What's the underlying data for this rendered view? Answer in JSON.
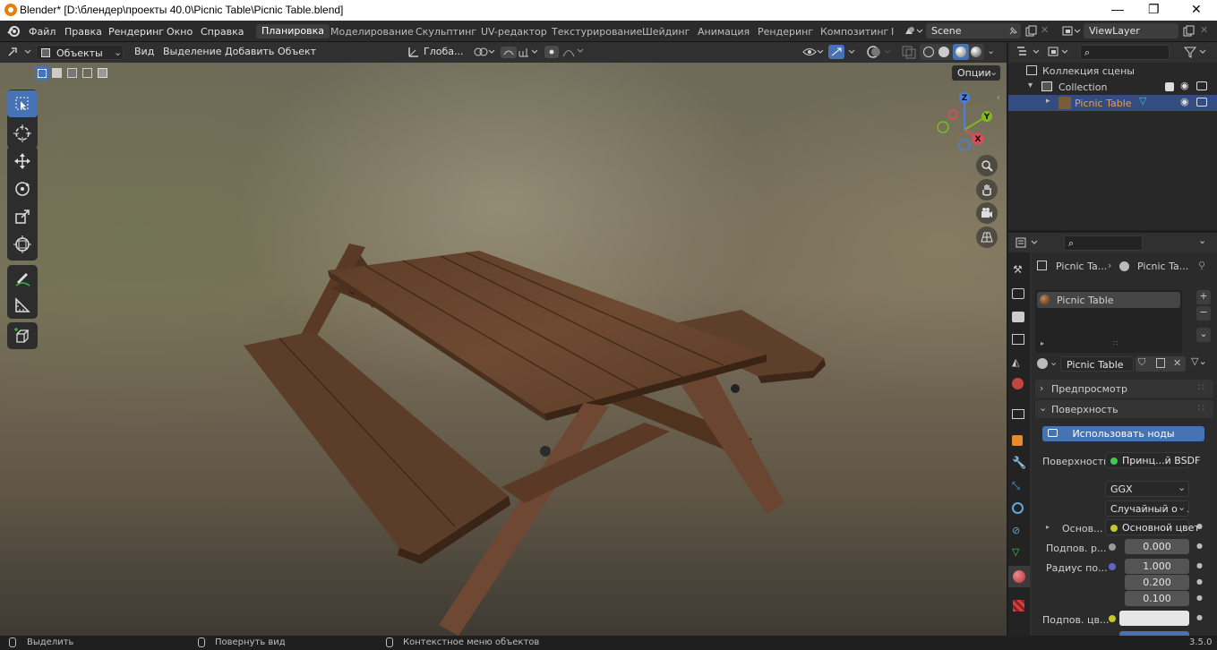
{
  "window": {
    "title": "Blender* [D:\\блендер\\проекты 40.0\\Picnic Table\\Picnic Table.blend]",
    "controls": [
      "—",
      "❐",
      "✕"
    ]
  },
  "menubar": {
    "menus": [
      "Файл",
      "Правка",
      "Рендеринг",
      "Окно",
      "Справка"
    ],
    "workspaces": [
      "Планировка",
      "Моделирование",
      "Скульптинг",
      "UV-редактор",
      "Текстурирование",
      "Шейдинг",
      "Анимация",
      "Рендеринг",
      "Композитинг"
    ],
    "active_workspace": "Планировка",
    "more_marker": "I",
    "scene": "Scene",
    "view_layer": "ViewLayer"
  },
  "viewport_header": {
    "mode": "Объекты",
    "menus": [
      "Вид",
      "Выделение",
      "Добавить",
      "Объект"
    ],
    "orientation": "Глоба...",
    "options": "Опции"
  },
  "toolbar": {
    "tools": [
      "select-box",
      "cursor",
      "move",
      "rotate",
      "scale",
      "transform",
      "annotate",
      "measure",
      "add-cube"
    ],
    "active_tool": "select-box"
  },
  "gizmo": {
    "axes": [
      "Z",
      "Y",
      "X"
    ]
  },
  "outliner": {
    "scene_collection": "Коллекция сцены",
    "collection": "Collection",
    "object": "Picnic Table"
  },
  "properties": {
    "breadcrumb_object": "Picnic Ta...",
    "breadcrumb_material": "Picnic Ta...",
    "slot_name": "Picnic Table",
    "material_name": "Picnic Table",
    "panels": {
      "preview": "Предпросмотр",
      "surface": "Поверхность"
    },
    "use_nodes_button": "Использовать ноды",
    "surface_label": "Поверхность",
    "surface_shader": "Принц...й BSDF",
    "distribution": "GGX",
    "subsurface_method": "Случайный об...",
    "rows": [
      {
        "label": "Основ...",
        "value": "Основной цвет"
      },
      {
        "label": "Подпов. р...",
        "value": "0.000"
      },
      {
        "label": "Радиус по...",
        "values": [
          "1.000",
          "0.200",
          "0.100"
        ]
      },
      {
        "label": "Подпов. цв...",
        "value": ""
      }
    ]
  },
  "statusbar": {
    "items": [
      "Выделить",
      "Повернуть вид",
      "Контекстное меню объектов"
    ],
    "version": "3.5.0"
  },
  "colors": {
    "accent": "#4772b3",
    "selection": "#334d80",
    "wood": "#6a4630",
    "title_bg": "#ffffff"
  }
}
